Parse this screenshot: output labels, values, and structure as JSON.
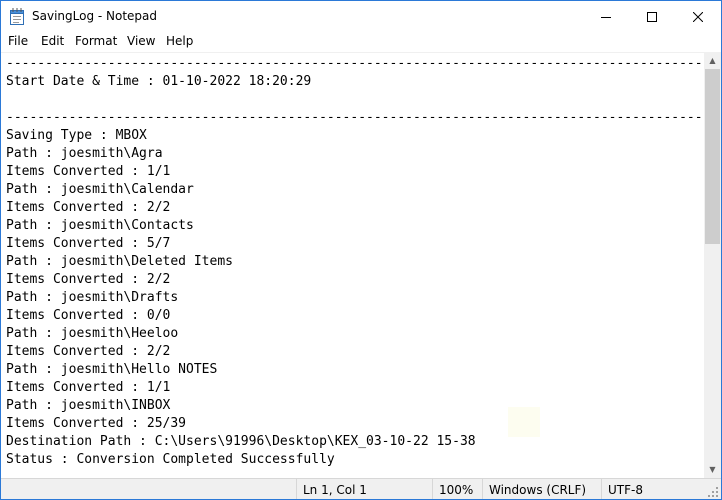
{
  "window": {
    "title": "SavingLog - Notepad"
  },
  "menu": {
    "file": "File",
    "edit": "Edit",
    "format": "Format",
    "view": "View",
    "help": "Help"
  },
  "editor": {
    "lines": [
      "-----------------------------------------------------------------------------------------",
      "Start Date & Time : 01-10-2022 18:20:29",
      "",
      "-----------------------------------------------------------------------------------------",
      "Saving Type : MBOX",
      "Path : joesmith\\Agra",
      "Items Converted : 1/1",
      "Path : joesmith\\Calendar",
      "Items Converted : 2/2",
      "Path : joesmith\\Contacts",
      "Items Converted : 5/7",
      "Path : joesmith\\Deleted Items",
      "Items Converted : 2/2",
      "Path : joesmith\\Drafts",
      "Items Converted : 0/0",
      "Path : joesmith\\Heeloo",
      "Items Converted : 2/2",
      "Path : joesmith\\Hello NOTES",
      "Items Converted : 1/1",
      "Path : joesmith\\INBOX",
      "Items Converted : 25/39",
      "Destination Path : C:\\Users\\91996\\Desktop\\KEX_03-10-22 15-38",
      "Status : Conversion Completed Successfully"
    ]
  },
  "status": {
    "position": "Ln 1, Col 1",
    "zoom": "100%",
    "line_endings": "Windows (CRLF)",
    "encoding": "UTF-8"
  },
  "icons": {
    "app": "notepad-icon",
    "minimize": "minimize-icon",
    "maximize": "maximize-icon",
    "close": "close-icon"
  }
}
